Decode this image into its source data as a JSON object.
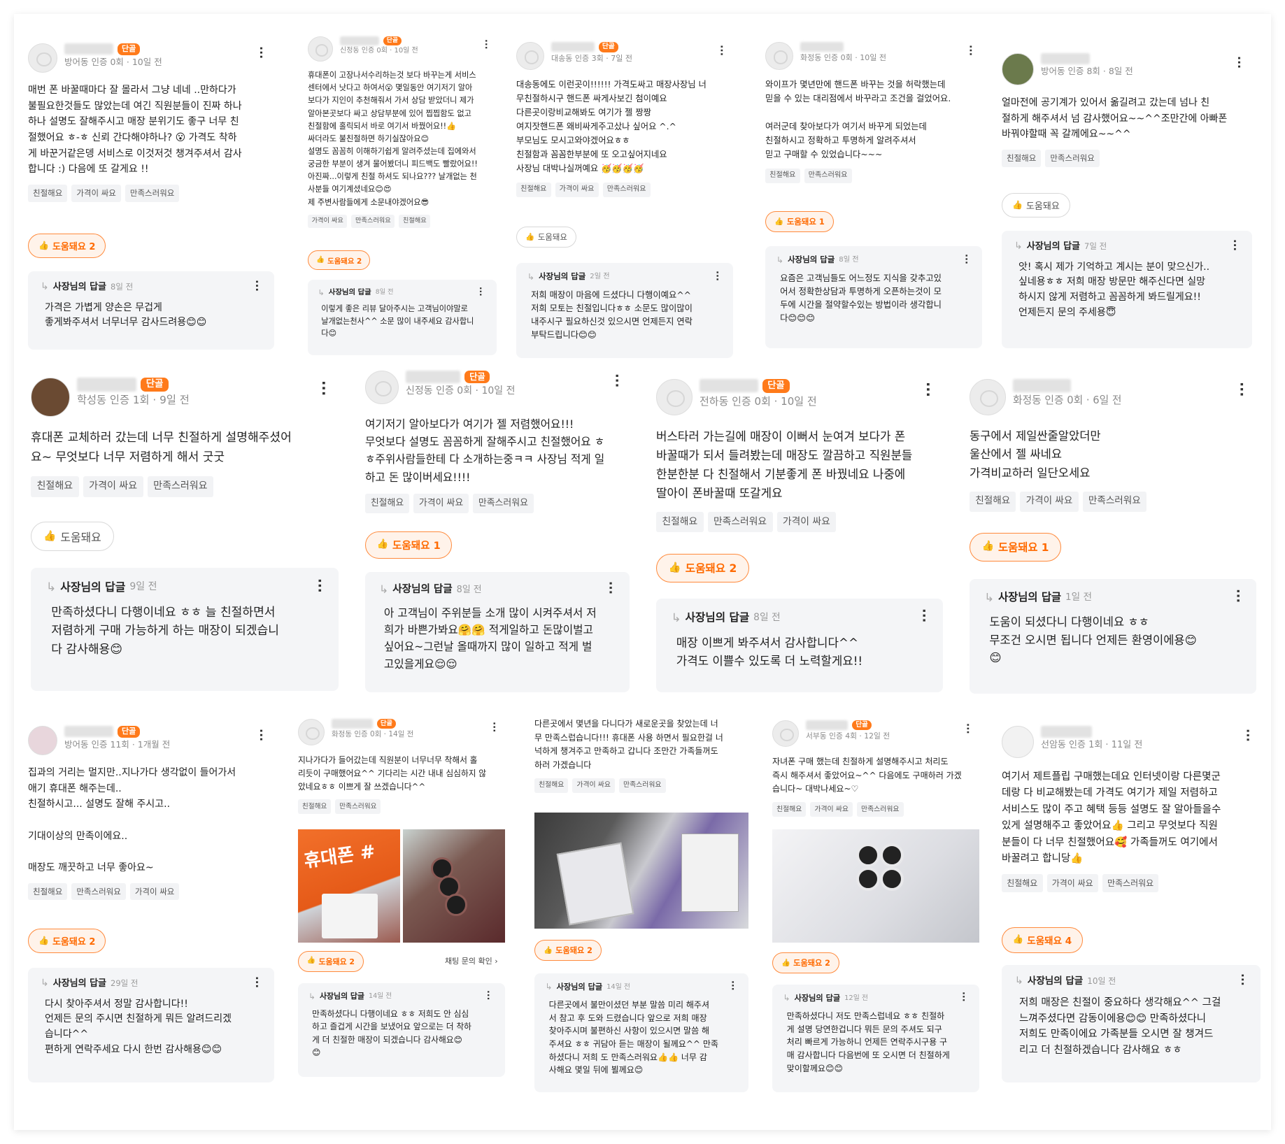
{
  "common": {
    "owner_reply_label": "사장님의 답글",
    "helpful_label": "도움돼요",
    "regular_badge": "단골",
    "chat_inquiry": "채팅 문의 확인 ›"
  },
  "reviews": [
    {
      "meta": "방어동 인증 0회 · 10일 전",
      "badge": true,
      "text": "매번 폰 바꿀때마다 잘 몰라서 그냥 네네 ..만하다가\n불필요한것들도 많았는데 여긴 직원분들이 진짜 하나\n하나 설명도 잘해주시고 매장 분위기도 좋구 너무 친\n절했어요 ㅎ-ㅎ 신뢰 간다해야하나? 😮 가격도 착하\n게 바꾼거같은뎅 서비스로 이것저것 챙겨주셔서 감사\n합니다 :) 다음에 또 갈게요 !!",
      "tags": [
        "친절해요",
        "가격이 싸요",
        "만족스러워요"
      ],
      "helpful": "도움돼요 2",
      "reply_time": "8일 전",
      "reply": "가격은 가볍게 양손은 무겁게\n좋게봐주셔서 너무너무 감사드려용😊😊"
    },
    {
      "meta": "신정동 인증 0회 · 10일 전",
      "badge": true,
      "text": "휴대폰이 고장나서수리하는것 보다 바꾸는게 서비스\n센터에서 낫다고 하여서😮 몇일동안 여기저기 알아\n보다가 지인이 추천해줘서 가서 상담 받았더니 제가\n알아본곳보다 싸고 상담부분에 있어 찝찝함도 없고\n친절함에 홀릭되서 바로 여기서 바꿨어요!!👍\n싸더라도 불친절하면 하기실잖아요😊\n설명도 꼼꼼히 이해하기쉽게 알려주셨는데 집에와서\n궁금한 부분이 생겨 물어봤더니 피드백도 빨랐어요!!\n아진짜...이렇게 친절 하셔도 되나요??? 날개없는 천\n사분들 여기계셨네요😊😍\n제 주변사람들에게 소문내야겠어요😎",
      "tags": [
        "가격이 싸요",
        "만족스러워요",
        "친절해요"
      ],
      "helpful": "도움돼요 2",
      "reply_time": "8일 전",
      "reply": "이렇게 좋은 리뷰 달아주시는 고객님이야말로\n날개없는천사^^ 소문 많이 내주세요 감사합니\n다😊"
    },
    {
      "meta": "대송동 인증 3회 · 7일 전",
      "badge": true,
      "text": "대송동에도 이런곳이!!!!!! 가격도싸고 매장사장님 너\n무친절하시구 핸드폰 싸게사보긴 첨이예요\n다른곳이랑비교해봐도 여기가 젤 짱짱\n여지잣핸드폰 왜비싸게주고샀나 싶어요 ^.^\n부모님도 모시고와야겠어요ㅎㅎ\n친절함과 꼼꼼한부분에 또 오고싶어지네요\n사장님 대박나실꺼예요 🥳🥳🥳🥳",
      "tags": [
        "친절해요",
        "가격이 싸요",
        "만족스러워요"
      ],
      "helpful": "도움돼요",
      "reply_time": "2일 전",
      "reply": "저희 매장이 마음에 드셨다니 다행이예요^^\n저희 모토는 친절입니다ㅎㅎ 소문도 많이많이\n내주시구 필요하신것 있으시면 언제든지 연락\n부탁드립니다😊😊"
    },
    {
      "meta": "화정동 인증 0회 · 10일 전",
      "badge": false,
      "text": "와이프가 몇년만에 핸드폰 바꾸는 것을 허락했는데\n믿을 수 있는 대리점에서 바꾸라고 조건을 걸었어요.\n\n여러군데 찾아보다가 여기서 바꾸게 되었는데\n친절하시고 정확하고 투명하게 알려주셔서\n믿고 구매할 수 있었습니다~~~",
      "tags": [
        "친절해요",
        "만족스러워요"
      ],
      "helpful": "도움돼요 1",
      "reply_time": "8일 전",
      "reply": "요즘은 고객님들도 어느정도 지식을 갖추고있\n어서 정확한상담과 투명하게 오픈하는것이 모\n두에 시간을 절약할수있는 방법이라 생각합니\n다😊😊😊"
    },
    {
      "meta": "방어동 인증 8회 · 8일 전",
      "badge": false,
      "text": "얼마전에 공기계가 있어서 옮길려고 갔는데 넘나 친\n절하게 해주셔서 넘 감사했어요~~^^조만간에 아빠폰\n바꿔야할때 꼭 갈께에요~~^^",
      "tags": [
        "친절해요",
        "만족스러워요"
      ],
      "helpful": "도움돼요",
      "reply_time": "7일 전",
      "reply": "앗! 혹시 제가 기억하고 계시는 분이 맞으신가..\n싶네용ㅎㅎ 저희 매장 방문만 해주신다면 실망\n하시지 않게 저렴하고 꼼꼼하게 봐드릴게요!!\n언제든지 문의 주세용😇"
    },
    {
      "meta": "학성동 인증 1회 · 9일 전",
      "badge": true,
      "text": "휴대폰 교체하러 갔는데 너무 친절하게 설명해주셨어\n요~ 무엇보다 너무 저렴하게 해서 굿굿",
      "tags": [
        "친절해요",
        "가격이 싸요",
        "만족스러워요"
      ],
      "helpful": "도움돼요",
      "reply_time": "9일 전",
      "reply": "만족하셨다니 다행이네요 ㅎㅎ 늘 친절하면서\n저렴하게 구매 가능하게 하는 매장이 되겠습니\n다 감사해용😊"
    },
    {
      "meta": "신정동 인증 0회 · 10일 전",
      "badge": true,
      "text": "여기저기 알아보다가 여기가 젤 저렴했어요!!!\n무엇보다 설명도 꼼꼼하게 잘해주시고 친절했어요 ㅎ\nㅎ주위사람들한테 다 소개하는중ㅋㅋ 사장님 적게 일\n하고 돈 많이버세요!!!!",
      "tags": [
        "친절해요",
        "가격이 싸요",
        "만족스러워요"
      ],
      "helpful": "도움돼요 1",
      "reply_time": "8일 전",
      "reply": "아 고객님이 주위분들 소개 많이 시켜주셔서 저\n희가 바쁜가봐요🤗🤗 적게일하고 돈많이벌고\n싶어요~그런날 올때까지 많이 일하고 적게 벌\n고있을게요😌😌"
    },
    {
      "meta": "전하동 인증 0회 · 10일 전",
      "badge": true,
      "text": "버스타러 가는길에 매장이 이뻐서 눈여겨 보다가 폰\n바꿀때가 되서 들려봤는데 매장도 깔끔하고 직원분들\n한분한분 다 친절해서 기분좋게 폰 바꿨네요 나중에\n딸아이 폰바꿀때 또갈게요",
      "tags": [
        "친절해요",
        "만족스러워요",
        "가격이 싸요"
      ],
      "helpful": "도움돼요 2",
      "reply_time": "8일 전",
      "reply": "매장 이쁘게 봐주셔서 감사합니다^^\n가격도 이쁠수 있도록 더 노력할게요!!"
    },
    {
      "meta": "화정동 인증 0회 · 6일 전",
      "badge": false,
      "text": "동구에서 제일싼줄알았더만\n울산에서 젤 싸네요\n가격비교하러 일단오세요",
      "tags": [
        "친절해요",
        "가격이 싸요",
        "만족스러워요"
      ],
      "helpful": "도움돼요 1",
      "reply_time": "1일 전",
      "reply": "도움이 되셨다니 다행이네요 ㅎㅎ\n무조건 오시면 됩니다 언제든 환영이에용😊\n😊"
    },
    {
      "meta": "방어동 인증 11회 · 1개월 전",
      "badge": true,
      "text": "집과의 거리는 멀지만..지나가다 생각없이 들어가서\n애기 휴대폰 해주는데..\n친절하시고... 설명도 잘해 주시고..\n\n기대이상의 만족이에요..\n\n매장도 깨끗하고 너무 좋아요~",
      "tags": [
        "친절해요",
        "만족스러워요",
        "가격이 싸요"
      ],
      "helpful": "도움돼요 2",
      "reply_time": "29일 전",
      "reply": "다시 찾아주셔서 정말 감사합니다!!\n언제든 문의 주시면 친절하게 뭐든 알려드리겠\n습니다^^\n편하게 연락주세요 다시 한번 감사해용😊😊"
    },
    {
      "meta": "화정동 인증 0회 · 14일 전",
      "badge": true,
      "text": "지나가다가 들어갔는데 직원분이 너무너무 착해서 홀\n리듯이 구매했어요^^ 기다리는 시간 내내 심심하지 않\n았네요ㅎㅎ 이쁘게 잘 쓰겠습니다^^",
      "tags": [
        "친절해요",
        "만족스러워요"
      ],
      "helpful": "도움돼요 2",
      "reply_time": "14일 전",
      "reply": "만족하셨다니 다행이네요 ㅎㅎ 저희도 안 심심\n하고 즐겁게 시간을 보냈어요 앞으로는 더 착하\n게 더 친절한 매장이 되겠습니다 감사해요😊\n😊"
    },
    {
      "meta": "",
      "badge": false,
      "text": "다른곳에서 몇년을 다니다가 새로운곳을 찾았는데 너\n무 만족스럽습니다!!! 휴대폰 사용 하면서 필요한걸 너\n넉하게 챙겨주고 만족하고 갑니다 조만간 가족들꺼도\n하러 가겠습니다",
      "tags": [
        "친절해요",
        "가격이 싸요",
        "만족스러워요"
      ],
      "helpful": "도움돼요 2",
      "reply_time": "14일 전",
      "reply": "다른곳에서 불만이셨던 부분 말씀 미리 해주셔\n서 참고 후 도와 드렸습니다 앞으로 저희 매장\n찾아주시며 불편하신 사항이 있으시면 말씀 해\n주셔요 ㅎㅎ 귀담아 듣는 매장이 될께요^^ 만족\n하셨다니 저희 도 만족스러워요👍👍 너무 감\n사해요 몇일 뒤에 뵐께요😊"
    },
    {
      "meta": "서부동 인증 4회 · 12일 전",
      "badge": true,
      "text": "자녀폰 구매 했는데 친절하게 설명해주시고 처리도\n즉시 해주셔서 좋았어요~^^ 다음에도 구매하러 가겠\n습니다~ 대박나세요~♡",
      "tags": [
        "친절해요",
        "가격이 싸요",
        "만족스러워요"
      ],
      "helpful": "도움돼요 2",
      "reply_time": "12일 전",
      "reply": "만족하셨다니 저도 만족스럽네요 ㅎㅎ 친절하\n게 설명 당연한겁니다 뭐든 문의 주셔도 되구\n처리 빠르게 가능하니 언제든 연락주시구용 구\n매 감사합니다 다음번에 또 오시면 더 친절하게\n맞이할께요😊😊"
    },
    {
      "meta": "선암동 인증 1회 · 11일 전",
      "badge": false,
      "text": "여기서 제트플립 구매했는데요 인터넷이랑 다른몇군\n데랑 다 비교해봤는데 가격도 여기가 제일 저렴하고\n서비스도 많이 주고 혜택 등등 설명도 잘 알아들을수\n있게 설명해주고 좋았어요👍 그리고 무엇보다 직원\n분들이 다 너무 친절했어요🥰 가족들꺼도 여기에서\n바꿀려고 합니당👍",
      "tags": [
        "친절해요",
        "가격이 싸요",
        "만족스러워요"
      ],
      "helpful": "도움돼요 4",
      "reply_time": "10일 전",
      "reply": "저희 매장은 친절이 중요하다 생각해요^^ 그걸\n느껴주셨다면 감동이에용😊😊 만족하셨다니\n저희도 만족이에요 가족분들 오시면 잘 챙겨드\n리고 더 친절하겠습니다 감사해요 ㅎㅎ"
    }
  ],
  "photo_labels": {
    "card11_left": "휴대폰 #"
  }
}
